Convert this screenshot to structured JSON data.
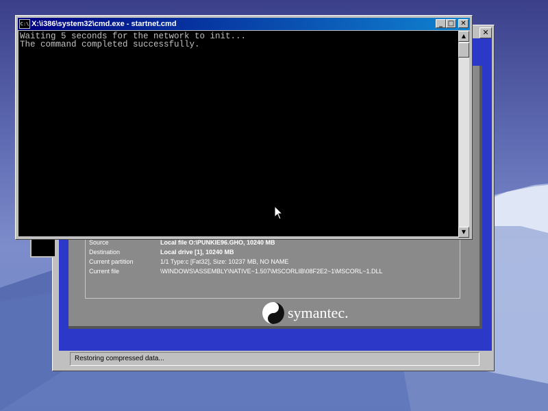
{
  "cmd_window": {
    "title": "X:\\i386\\system32\\cmd.exe - startnet.cmd",
    "icon_label": "C:\\",
    "icon": "console-icon",
    "controls": {
      "minimize": "_",
      "maximize": "□",
      "close": "✕"
    },
    "console_lines": [
      "Waiting 5 seconds for the network to init...",
      "The command completed successfully."
    ]
  },
  "ghost_window": {
    "close": "✕",
    "details": [
      {
        "label": "Source",
        "value": "Local file O:\\PUNKIE96.GHO, 10240 MB"
      },
      {
        "label": "Destination",
        "value": "Local drive [1], 10240 MB"
      },
      {
        "label": "Current partition",
        "value": "1/1 Type:c [Fat32], Size: 10237 MB, NO NAME"
      },
      {
        "label": "Current file",
        "value": "\\WINDOWS\\ASSEMBLY\\NATIVE~1.507\\MSCORLIB\\08F2E2~1\\MSCORL~1.DLL"
      }
    ],
    "logo_text": "symantec.",
    "status_text": "Restoring compressed data..."
  }
}
